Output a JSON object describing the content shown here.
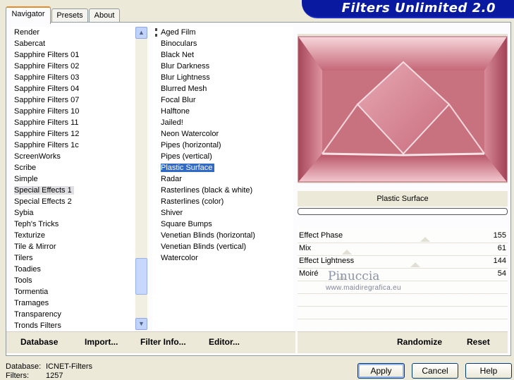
{
  "banner": {
    "title": "Filters Unlimited 2.0"
  },
  "tabs": [
    {
      "label": "Navigator"
    },
    {
      "label": "Presets"
    },
    {
      "label": "About"
    }
  ],
  "categories": [
    {
      "label": "Render"
    },
    {
      "label": "Sabercat"
    },
    {
      "label": "Sapphire Filters 01"
    },
    {
      "label": "Sapphire Filters 02"
    },
    {
      "label": "Sapphire Filters 03"
    },
    {
      "label": "Sapphire Filters 04"
    },
    {
      "label": "Sapphire Filters 07"
    },
    {
      "label": "Sapphire Filters 10"
    },
    {
      "label": "Sapphire Filters 11"
    },
    {
      "label": "Sapphire Filters 12"
    },
    {
      "label": "Sapphire Filters 1c"
    },
    {
      "label": "ScreenWorks"
    },
    {
      "label": "Scribe"
    },
    {
      "label": "Simple"
    },
    {
      "label": "Special Effects 1"
    },
    {
      "label": "Special Effects 2"
    },
    {
      "label": "Sybia"
    },
    {
      "label": "Teph's Tricks"
    },
    {
      "label": "Texturize"
    },
    {
      "label": "Tile & Mirror"
    },
    {
      "label": "Tilers"
    },
    {
      "label": "Toadies"
    },
    {
      "label": "Tools"
    },
    {
      "label": "Tormentia"
    },
    {
      "label": "Tramages"
    },
    {
      "label": "Transparency"
    },
    {
      "label": "Tronds Filters"
    }
  ],
  "filters": [
    {
      "label": "Aged Film"
    },
    {
      "label": "Binoculars"
    },
    {
      "label": "Black Net"
    },
    {
      "label": "Blur Darkness"
    },
    {
      "label": "Blur Lightness"
    },
    {
      "label": "Blurred Mesh"
    },
    {
      "label": "Focal Blur"
    },
    {
      "label": "Halftone"
    },
    {
      "label": "Jailed!"
    },
    {
      "label": "Neon Watercolor"
    },
    {
      "label": "Pipes (horizontal)"
    },
    {
      "label": "Pipes (vertical)"
    },
    {
      "label": "Plastic Surface"
    },
    {
      "label": "Radar"
    },
    {
      "label": "Rasterlines (black & white)"
    },
    {
      "label": "Rasterlines (color)"
    },
    {
      "label": "Shiver"
    },
    {
      "label": "Square Bumps"
    },
    {
      "label": "Venetian Blinds (horizontal)"
    },
    {
      "label": "Venetian Blinds (vertical)"
    },
    {
      "label": "Watercolor"
    }
  ],
  "left_actions": {
    "database": "Database",
    "import": "Import...",
    "filter_info": "Filter Info...",
    "editor": "Editor..."
  },
  "filter_name": "Plastic Surface",
  "params": [
    {
      "name": "Effect Phase",
      "value": "155"
    },
    {
      "name": "Mix",
      "value": "61"
    },
    {
      "name": "Effect Lightness",
      "value": "144"
    },
    {
      "name": "Moiré",
      "value": "54"
    }
  ],
  "watermark": {
    "name": "Pinuccia",
    "url": "www.maidiregrafica.eu"
  },
  "right_actions": {
    "randomize": "Randomize",
    "reset": "Reset"
  },
  "status": {
    "database_label": "Database:",
    "database_value": "ICNET-Filters",
    "filters_label": "Filters:",
    "filters_value": "1257"
  },
  "buttons": {
    "apply": "Apply",
    "cancel": "Cancel",
    "help": "Help"
  }
}
